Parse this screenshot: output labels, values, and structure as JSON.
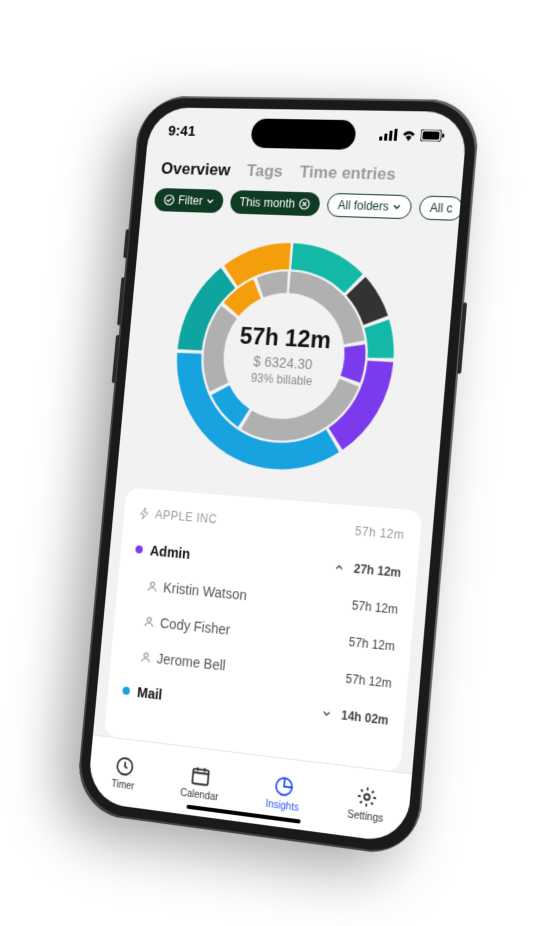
{
  "status": {
    "time": "9:41"
  },
  "tabs": {
    "overview": "Overview",
    "tags": "Tags",
    "entries": "Time entries"
  },
  "filters": {
    "filter": "Filter",
    "period": "This month",
    "folders": "All folders",
    "extra": "All c"
  },
  "summary": {
    "time": "57h 12m",
    "amount": "$ 6324.30",
    "billable": "93% billable"
  },
  "chart_data": {
    "type": "donut",
    "series_outer": [
      {
        "name": "teal",
        "color": "#14b8a6",
        "value": 12
      },
      {
        "name": "dark",
        "color": "#333333",
        "value": 7
      },
      {
        "name": "teal2",
        "color": "#14b8a6",
        "value": 6
      },
      {
        "name": "purple",
        "color": "#7c3aed",
        "value": 15
      },
      {
        "name": "blue",
        "color": "#17a2e0",
        "value": 35
      },
      {
        "name": "teal3",
        "color": "#0ea5a0",
        "value": 14
      },
      {
        "name": "orange",
        "color": "#f59e0b",
        "value": 11
      }
    ],
    "series_inner": [
      {
        "name": "grey",
        "color": "#b0b0b0",
        "value": 22
      },
      {
        "name": "purple",
        "color": "#7c3aed",
        "value": 8
      },
      {
        "name": "grey2",
        "color": "#b0b0b0",
        "value": 28
      },
      {
        "name": "blue",
        "color": "#17a2e0",
        "value": 9
      },
      {
        "name": "grey3",
        "color": "#b0b0b0",
        "value": 18
      },
      {
        "name": "orange",
        "color": "#f59e0b",
        "value": 8
      },
      {
        "name": "grey4",
        "color": "#b0b0b0",
        "value": 7
      }
    ]
  },
  "card": {
    "company": "APPLE INC",
    "company_time": "57h 12m",
    "groups": [
      {
        "name": "Admin",
        "color": "purple",
        "expanded": true,
        "time": "27h 12m",
        "members": [
          {
            "name": "Kristin Watson",
            "time": "57h 12m"
          },
          {
            "name": "Cody Fisher",
            "time": "57h 12m"
          },
          {
            "name": "Jerome Bell",
            "time": "57h 12m"
          }
        ]
      },
      {
        "name": "Mail",
        "color": "blue",
        "expanded": false,
        "time": "14h 02m",
        "members": []
      }
    ]
  },
  "nav": {
    "timer": "Timer",
    "calendar": "Calendar",
    "insights": "Insights",
    "settings": "Settings"
  }
}
